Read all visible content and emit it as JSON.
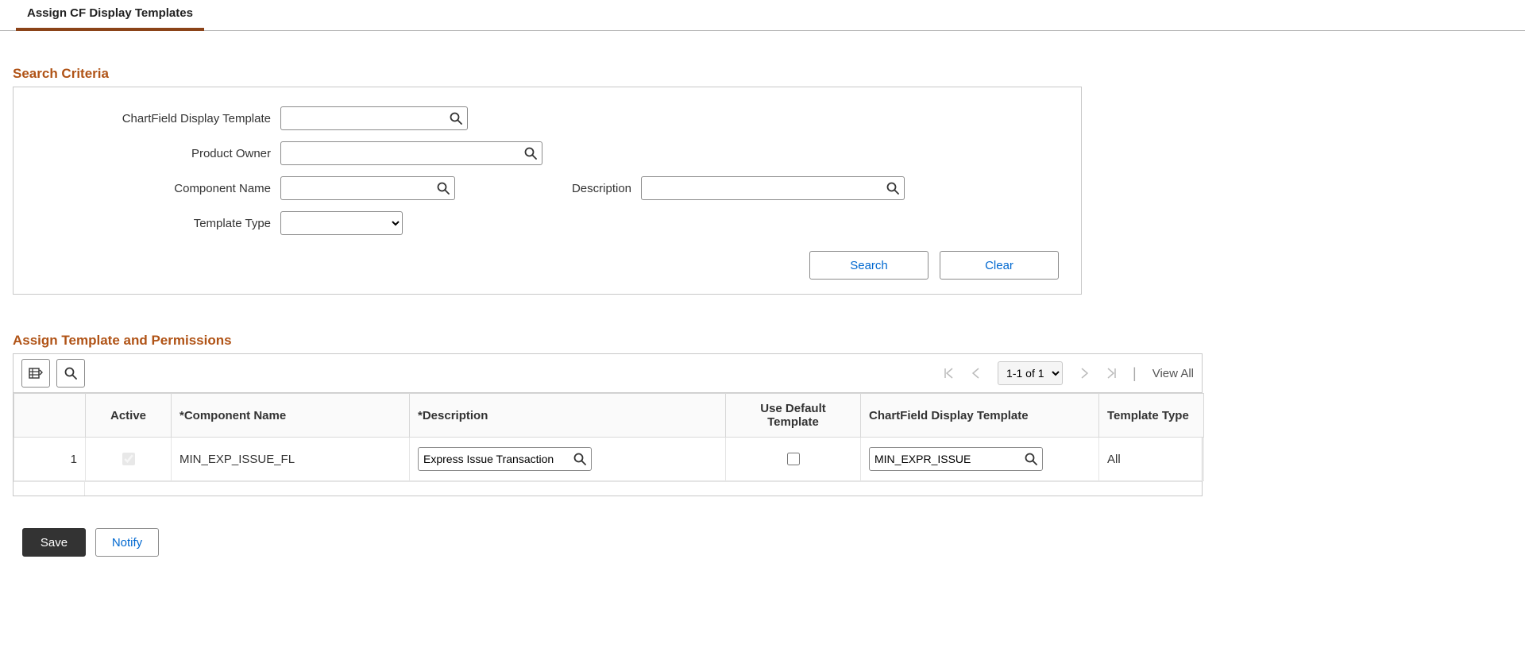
{
  "tab": {
    "label": "Assign CF Display Templates"
  },
  "search_criteria": {
    "title": "Search Criteria",
    "fields": {
      "cf_template": {
        "label": "ChartField Display Template",
        "value": ""
      },
      "product_owner": {
        "label": "Product Owner",
        "value": ""
      },
      "component_name": {
        "label": "Component Name",
        "value": ""
      },
      "description": {
        "label": "Description",
        "value": ""
      },
      "template_type": {
        "label": "Template Type",
        "value": ""
      }
    },
    "buttons": {
      "search": "Search",
      "clear": "Clear"
    }
  },
  "assign_section": {
    "title": "Assign Template and Permissions",
    "pager": {
      "text": "1-1 of 1",
      "view_all": "View All"
    },
    "columns": {
      "row_num": "",
      "active": "Active",
      "component_name": "*Component Name",
      "description": "*Description",
      "use_default": "Use Default Template",
      "cf_template": "ChartField Display Template",
      "template_type": "Template Type"
    },
    "rows": [
      {
        "num": "1",
        "active": true,
        "active_disabled": true,
        "component_name": "MIN_EXP_ISSUE_FL",
        "description": "Express Issue Transaction",
        "use_default": false,
        "cf_template": "MIN_EXPR_ISSUE",
        "template_type": "All"
      }
    ]
  },
  "footer": {
    "save": "Save",
    "notify": "Notify"
  }
}
